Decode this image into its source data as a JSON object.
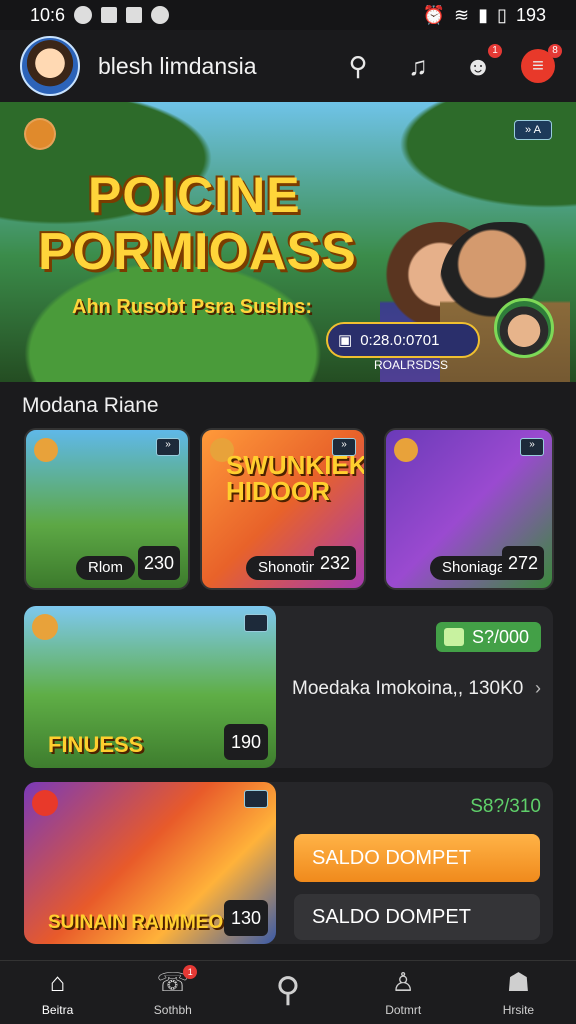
{
  "status_bar": {
    "time": "10:6",
    "battery": "193"
  },
  "header": {
    "username": "blesh limdansia",
    "icon_badges": [
      "1",
      "8"
    ]
  },
  "banner": {
    "title_line1": "POICINE",
    "title_line2": "PORMIOASS",
    "subtitle": "Ahn Rusobt Psra Suslns:",
    "tag": "» A",
    "pill_text": "0:28.0:0701",
    "pill_sub": "ROALRSDSS"
  },
  "section": {
    "title": "Modana Riane"
  },
  "tiles": [
    {
      "label": "Rlom",
      "number": "230",
      "title": ""
    },
    {
      "label": "Shonotin",
      "number": "232",
      "title": "SWUNKIEK HIDOOR"
    },
    {
      "label": "Shoniaga",
      "number": "272",
      "title": ""
    }
  ],
  "card1": {
    "image_title": "FINUESS",
    "image_number": "190",
    "price": "S?/000",
    "description": "Moedaka Imokoina,, 130K0",
    "chevron": "›"
  },
  "card2": {
    "image_title": "SUINAIN RAIMMEOY",
    "image_number": "130",
    "price": "S8?/310",
    "button_primary": "SALDO DOMPET",
    "button_secondary": "SALDO DOMPET"
  },
  "tabbar": {
    "tabs": [
      {
        "label": "Beitra",
        "icon": "home-icon"
      },
      {
        "label": "Sothbh",
        "icon": "chat-icon",
        "badge": "1"
      },
      {
        "label": "",
        "icon": "search-icon"
      },
      {
        "label": "Dotmrt",
        "icon": "user-icon"
      },
      {
        "label": "Hrsite",
        "icon": "profile-icon"
      }
    ]
  },
  "colors": {
    "accent_orange": "#f08a1c",
    "accent_green": "#43a047",
    "badge_red": "#e53935",
    "title_gold": "#ffd53a"
  }
}
